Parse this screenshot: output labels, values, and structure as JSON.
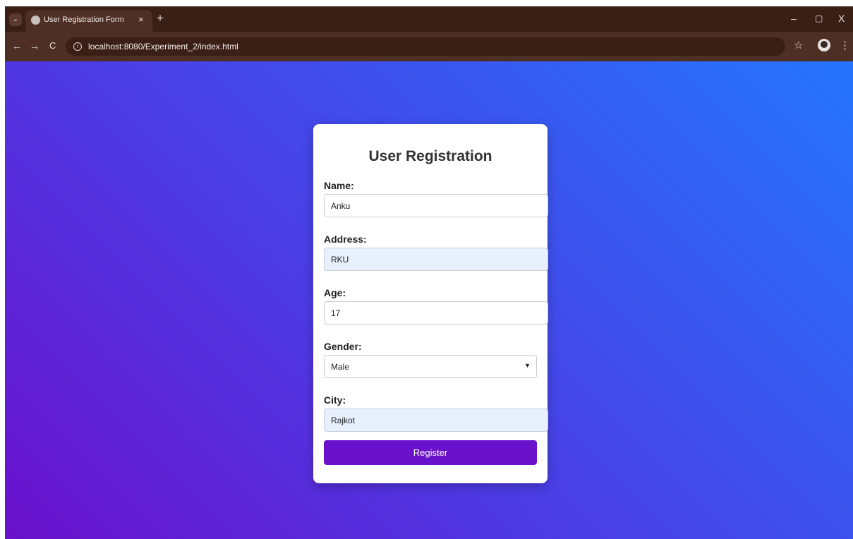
{
  "browser": {
    "tab_title": "User Registration Form",
    "url": "localhost:8080/Experiment_2/index.html",
    "icons": {
      "tab_menu": "⌄",
      "tab_close": "×",
      "new_tab": "+",
      "minimize": "–",
      "restore": "▢",
      "close": "X",
      "back": "←",
      "forward": "→",
      "reload": "C",
      "info": "i",
      "star": "☆",
      "menu": "⋮"
    }
  },
  "page": {
    "gradient_start": "#6a11cb",
    "gradient_end": "#2575fc"
  },
  "form": {
    "title": "User Registration",
    "name_label": "Name:",
    "name_value": "Anku",
    "address_label": "Address:",
    "address_value": "RKU",
    "age_label": "Age:",
    "age_value": "17",
    "gender_label": "Gender:",
    "gender_value": "Male",
    "city_label": "City:",
    "city_value": "Rajkot",
    "register_label": "Register",
    "button_color": "#6a11cb"
  }
}
